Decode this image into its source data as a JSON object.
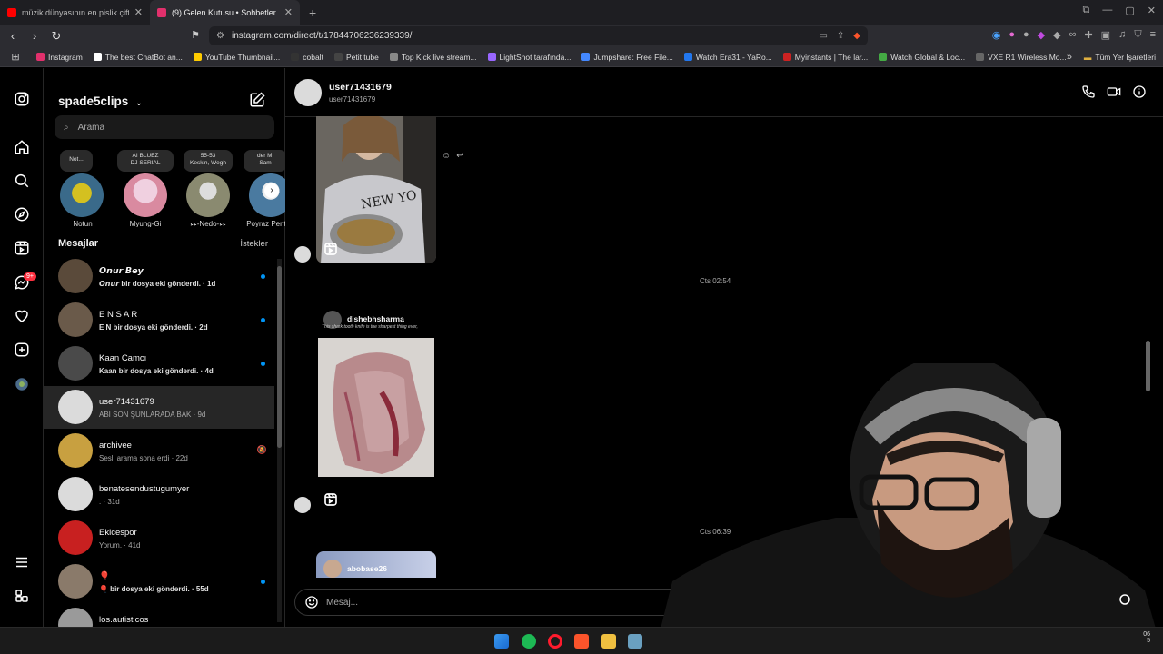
{
  "browser": {
    "tabs": [
      {
        "title": "müzik dünyasının en pislik çifti // die",
        "color": "#ff0000",
        "active": false
      },
      {
        "title": "(9) Gelen Kutusu • Sohbetler",
        "color": "#e1306c",
        "active": true
      }
    ],
    "new_tab": "+",
    "url": "instagram.com/direct/t/17844706236239339/",
    "bookmarks": [
      {
        "label": "Instagram",
        "color": "#e1306c"
      },
      {
        "label": "The best ChatBot an...",
        "color": "#ffffff"
      },
      {
        "label": "YouTube Thumbnail...",
        "color": "#ffcc00"
      },
      {
        "label": "cobalt",
        "color": "#333333"
      },
      {
        "label": "Petit tube",
        "color": "#444444"
      },
      {
        "label": "Top Kick live stream...",
        "color": "#888888"
      },
      {
        "label": "LightShot tarafında...",
        "color": "#9966ff"
      },
      {
        "label": "Jumpshare: Free File...",
        "color": "#4488ff"
      },
      {
        "label": "Watch Era31 - YaRo...",
        "color": "#2277ee"
      },
      {
        "label": "Myinstants | The lar...",
        "color": "#cc2222"
      },
      {
        "label": "Watch Global & Loc...",
        "color": "#44aa44"
      },
      {
        "label": "VXE R1 Wireless Mo...",
        "color": "#666666"
      }
    ],
    "bookmarks_more": "»",
    "all_bookmarks": "Tüm Yer İşaretleri"
  },
  "rail": {
    "icons": [
      "instagram-icon",
      "home-icon",
      "search-icon",
      "explore-icon",
      "reels-icon",
      "messenger-icon",
      "heart-icon",
      "create-icon",
      "profile-icon",
      "menu-icon",
      "threads-icon"
    ],
    "badge": "9+"
  },
  "panel": {
    "username": "spade5clips",
    "search_placeholder": "Arama",
    "notes": [
      {
        "bubble": "Not...",
        "name": "Notun",
        "color": "#3a6a8a"
      },
      {
        "bubble": "AI BLUEZ\nDJ SERIAL",
        "name": "Myung-Gi",
        "color": "#d98aa0"
      },
      {
        "bubble": "55-53\nKeskin, Wegh",
        "name": "ءء-Nedo-ءء",
        "color": "#8a8a70"
      },
      {
        "bubble": "der Mi\nSam",
        "name": "Poyraz Perit D",
        "color": "#4a7aa0"
      }
    ],
    "messages_title": "Mesajlar",
    "requests_label": "İstekler",
    "conversations": [
      {
        "name": "𝙊𝙣𝙪𝙧 𝘽𝙚𝙮",
        "preview": "𝙊𝙣𝙪𝙧 bir dosya eki gönderdi. · 1d",
        "unread": true,
        "active": false,
        "muted": false,
        "color": "#5a4a3a"
      },
      {
        "name": "E N S A R",
        "preview": "E N bir dosya eki gönderdi. · 2d",
        "unread": true,
        "active": false,
        "muted": false,
        "color": "#6a5a4a"
      },
      {
        "name": "Kaan Camcı",
        "preview": "Kaan bir dosya eki gönderdi. · 4d",
        "unread": true,
        "active": false,
        "muted": false,
        "color": "#4a4a4a"
      },
      {
        "name": "user71431679",
        "preview": "ABİ SON ŞUNLARADA BAK · 9d",
        "unread": false,
        "active": true,
        "muted": false,
        "color": "#dbdbdb"
      },
      {
        "name": "archivee",
        "preview": "Sesli arama sona erdi · 22d",
        "unread": false,
        "active": false,
        "muted": true,
        "color": "#c8a040"
      },
      {
        "name": "benatesendustugumyer",
        "preview": ". · 31d",
        "unread": false,
        "active": false,
        "muted": false,
        "color": "#dbdbdb"
      },
      {
        "name": "Ekicespor",
        "preview": "Yorum. · 41d",
        "unread": false,
        "active": false,
        "muted": false,
        "color": "#c82020"
      },
      {
        "name": "🎈",
        "preview": "🎈 bir dosya eki gönderdi. · 55d",
        "unread": true,
        "active": false,
        "muted": false,
        "color": "#8a7a6a"
      },
      {
        "name": "los.autisticos",
        "preview": "",
        "unread": false,
        "active": false,
        "muted": false,
        "color": "#9a9a9a"
      }
    ]
  },
  "chat": {
    "name": "user71431679",
    "subname": "user71431679",
    "timestamp1": "Cts 02:54",
    "timestamp2": "Cts 06:39",
    "shared_user": "dishebhsharma",
    "shared_caption": "This shark tooth knife is the sharpest thing ever,",
    "partial_user": "abobase26",
    "input_placeholder": "Mesaj..."
  },
  "taskbar": {
    "time": "06\n5"
  }
}
